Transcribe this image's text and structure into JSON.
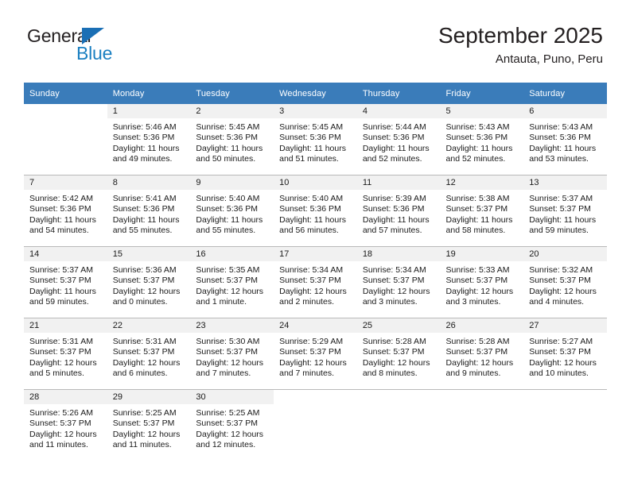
{
  "logo": {
    "top_word": "General",
    "bottom_word": "Blue",
    "triangle_icon": "blue-triangle-icon",
    "top_color": "#231f20",
    "bottom_color": "#1a7fc1"
  },
  "header": {
    "title": "September 2025",
    "subtitle": "Antauta, Puno, Peru"
  },
  "theme": {
    "header_bg": "#3a7cba",
    "header_text": "#ffffff",
    "daynum_bg": "#f1f1f1",
    "cell_bg": "#ffffff",
    "grid_line": "#b9b9b9"
  },
  "weekday_headers": [
    "Sunday",
    "Monday",
    "Tuesday",
    "Wednesday",
    "Thursday",
    "Friday",
    "Saturday"
  ],
  "weeks": [
    [
      {
        "day": "",
        "sunrise": "",
        "sunset": "",
        "daylight_a": "",
        "daylight_b": "",
        "blank": true
      },
      {
        "day": "1",
        "sunrise": "Sunrise: 5:46 AM",
        "sunset": "Sunset: 5:36 PM",
        "daylight_a": "Daylight: 11 hours",
        "daylight_b": "and 49 minutes."
      },
      {
        "day": "2",
        "sunrise": "Sunrise: 5:45 AM",
        "sunset": "Sunset: 5:36 PM",
        "daylight_a": "Daylight: 11 hours",
        "daylight_b": "and 50 minutes."
      },
      {
        "day": "3",
        "sunrise": "Sunrise: 5:45 AM",
        "sunset": "Sunset: 5:36 PM",
        "daylight_a": "Daylight: 11 hours",
        "daylight_b": "and 51 minutes."
      },
      {
        "day": "4",
        "sunrise": "Sunrise: 5:44 AM",
        "sunset": "Sunset: 5:36 PM",
        "daylight_a": "Daylight: 11 hours",
        "daylight_b": "and 52 minutes."
      },
      {
        "day": "5",
        "sunrise": "Sunrise: 5:43 AM",
        "sunset": "Sunset: 5:36 PM",
        "daylight_a": "Daylight: 11 hours",
        "daylight_b": "and 52 minutes."
      },
      {
        "day": "6",
        "sunrise": "Sunrise: 5:43 AM",
        "sunset": "Sunset: 5:36 PM",
        "daylight_a": "Daylight: 11 hours",
        "daylight_b": "and 53 minutes."
      }
    ],
    [
      {
        "day": "7",
        "sunrise": "Sunrise: 5:42 AM",
        "sunset": "Sunset: 5:36 PM",
        "daylight_a": "Daylight: 11 hours",
        "daylight_b": "and 54 minutes."
      },
      {
        "day": "8",
        "sunrise": "Sunrise: 5:41 AM",
        "sunset": "Sunset: 5:36 PM",
        "daylight_a": "Daylight: 11 hours",
        "daylight_b": "and 55 minutes."
      },
      {
        "day": "9",
        "sunrise": "Sunrise: 5:40 AM",
        "sunset": "Sunset: 5:36 PM",
        "daylight_a": "Daylight: 11 hours",
        "daylight_b": "and 55 minutes."
      },
      {
        "day": "10",
        "sunrise": "Sunrise: 5:40 AM",
        "sunset": "Sunset: 5:36 PM",
        "daylight_a": "Daylight: 11 hours",
        "daylight_b": "and 56 minutes."
      },
      {
        "day": "11",
        "sunrise": "Sunrise: 5:39 AM",
        "sunset": "Sunset: 5:36 PM",
        "daylight_a": "Daylight: 11 hours",
        "daylight_b": "and 57 minutes."
      },
      {
        "day": "12",
        "sunrise": "Sunrise: 5:38 AM",
        "sunset": "Sunset: 5:37 PM",
        "daylight_a": "Daylight: 11 hours",
        "daylight_b": "and 58 minutes."
      },
      {
        "day": "13",
        "sunrise": "Sunrise: 5:37 AM",
        "sunset": "Sunset: 5:37 PM",
        "daylight_a": "Daylight: 11 hours",
        "daylight_b": "and 59 minutes."
      }
    ],
    [
      {
        "day": "14",
        "sunrise": "Sunrise: 5:37 AM",
        "sunset": "Sunset: 5:37 PM",
        "daylight_a": "Daylight: 11 hours",
        "daylight_b": "and 59 minutes."
      },
      {
        "day": "15",
        "sunrise": "Sunrise: 5:36 AM",
        "sunset": "Sunset: 5:37 PM",
        "daylight_a": "Daylight: 12 hours",
        "daylight_b": "and 0 minutes."
      },
      {
        "day": "16",
        "sunrise": "Sunrise: 5:35 AM",
        "sunset": "Sunset: 5:37 PM",
        "daylight_a": "Daylight: 12 hours",
        "daylight_b": "and 1 minute."
      },
      {
        "day": "17",
        "sunrise": "Sunrise: 5:34 AM",
        "sunset": "Sunset: 5:37 PM",
        "daylight_a": "Daylight: 12 hours",
        "daylight_b": "and 2 minutes."
      },
      {
        "day": "18",
        "sunrise": "Sunrise: 5:34 AM",
        "sunset": "Sunset: 5:37 PM",
        "daylight_a": "Daylight: 12 hours",
        "daylight_b": "and 3 minutes."
      },
      {
        "day": "19",
        "sunrise": "Sunrise: 5:33 AM",
        "sunset": "Sunset: 5:37 PM",
        "daylight_a": "Daylight: 12 hours",
        "daylight_b": "and 3 minutes."
      },
      {
        "day": "20",
        "sunrise": "Sunrise: 5:32 AM",
        "sunset": "Sunset: 5:37 PM",
        "daylight_a": "Daylight: 12 hours",
        "daylight_b": "and 4 minutes."
      }
    ],
    [
      {
        "day": "21",
        "sunrise": "Sunrise: 5:31 AM",
        "sunset": "Sunset: 5:37 PM",
        "daylight_a": "Daylight: 12 hours",
        "daylight_b": "and 5 minutes."
      },
      {
        "day": "22",
        "sunrise": "Sunrise: 5:31 AM",
        "sunset": "Sunset: 5:37 PM",
        "daylight_a": "Daylight: 12 hours",
        "daylight_b": "and 6 minutes."
      },
      {
        "day": "23",
        "sunrise": "Sunrise: 5:30 AM",
        "sunset": "Sunset: 5:37 PM",
        "daylight_a": "Daylight: 12 hours",
        "daylight_b": "and 7 minutes."
      },
      {
        "day": "24",
        "sunrise": "Sunrise: 5:29 AM",
        "sunset": "Sunset: 5:37 PM",
        "daylight_a": "Daylight: 12 hours",
        "daylight_b": "and 7 minutes."
      },
      {
        "day": "25",
        "sunrise": "Sunrise: 5:28 AM",
        "sunset": "Sunset: 5:37 PM",
        "daylight_a": "Daylight: 12 hours",
        "daylight_b": "and 8 minutes."
      },
      {
        "day": "26",
        "sunrise": "Sunrise: 5:28 AM",
        "sunset": "Sunset: 5:37 PM",
        "daylight_a": "Daylight: 12 hours",
        "daylight_b": "and 9 minutes."
      },
      {
        "day": "27",
        "sunrise": "Sunrise: 5:27 AM",
        "sunset": "Sunset: 5:37 PM",
        "daylight_a": "Daylight: 12 hours",
        "daylight_b": "and 10 minutes."
      }
    ],
    [
      {
        "day": "28",
        "sunrise": "Sunrise: 5:26 AM",
        "sunset": "Sunset: 5:37 PM",
        "daylight_a": "Daylight: 12 hours",
        "daylight_b": "and 11 minutes."
      },
      {
        "day": "29",
        "sunrise": "Sunrise: 5:25 AM",
        "sunset": "Sunset: 5:37 PM",
        "daylight_a": "Daylight: 12 hours",
        "daylight_b": "and 11 minutes."
      },
      {
        "day": "30",
        "sunrise": "Sunrise: 5:25 AM",
        "sunset": "Sunset: 5:37 PM",
        "daylight_a": "Daylight: 12 hours",
        "daylight_b": "and 12 minutes."
      },
      {
        "day": "",
        "sunrise": "",
        "sunset": "",
        "daylight_a": "",
        "daylight_b": "",
        "blank": true
      },
      {
        "day": "",
        "sunrise": "",
        "sunset": "",
        "daylight_a": "",
        "daylight_b": "",
        "blank": true
      },
      {
        "day": "",
        "sunrise": "",
        "sunset": "",
        "daylight_a": "",
        "daylight_b": "",
        "blank": true
      },
      {
        "day": "",
        "sunrise": "",
        "sunset": "",
        "daylight_a": "",
        "daylight_b": "",
        "blank": true
      }
    ]
  ]
}
